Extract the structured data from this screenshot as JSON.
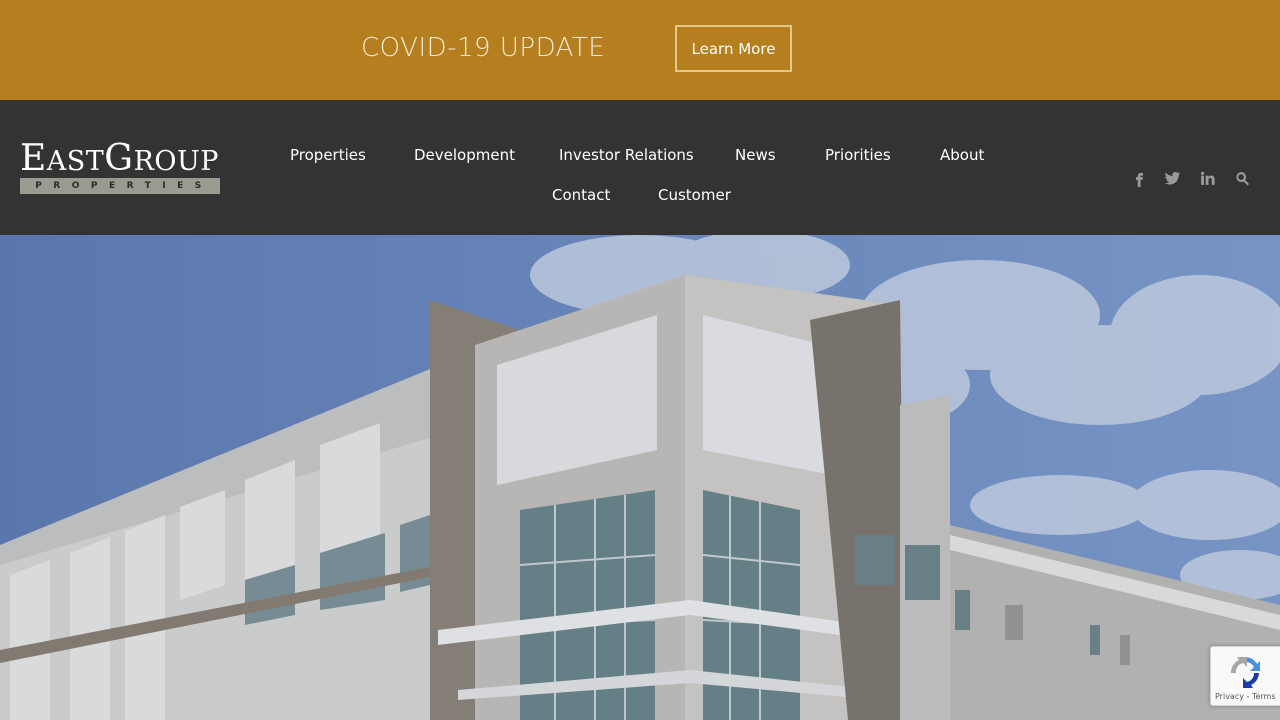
{
  "banner": {
    "title": "COVID-19 UPDATE",
    "button_label": "Learn More",
    "background": "#b57e1f"
  },
  "logo": {
    "word_first": "E",
    "word_mid": "AST",
    "word_g": "G",
    "word_end": "ROUP",
    "subtitle": "PROPERTIES"
  },
  "nav": {
    "items": [
      {
        "label": "Properties"
      },
      {
        "label": "Development"
      },
      {
        "label": "Investor Relations"
      },
      {
        "label": "News"
      },
      {
        "label": "Priorities"
      },
      {
        "label": "About"
      },
      {
        "label": "Contact"
      },
      {
        "label": "Customer"
      }
    ]
  },
  "social": [
    "facebook-icon",
    "twitter-icon",
    "linkedin-icon",
    "search-icon"
  ],
  "recaptcha": {
    "text": "Privacy - Terms"
  },
  "colors": {
    "header": "#333333",
    "accent": "#b57e1f"
  }
}
